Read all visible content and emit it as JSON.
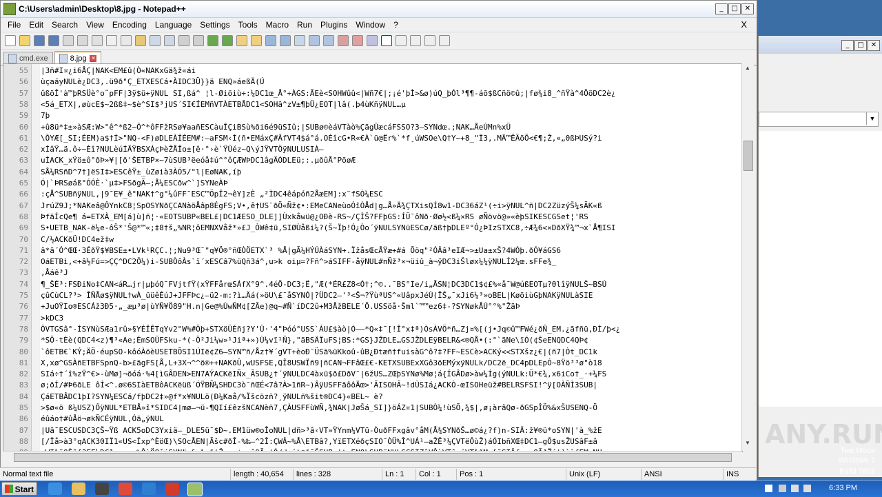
{
  "window": {
    "title": "C:\\Users\\admin\\Desktop\\8.jpg - Notepad++"
  },
  "menu": [
    "File",
    "Edit",
    "Search",
    "View",
    "Encoding",
    "Language",
    "Settings",
    "Tools",
    "Macro",
    "Run",
    "Plugins",
    "Window",
    "?"
  ],
  "menu_close": "X",
  "tabs": [
    {
      "label": "cmd.exe",
      "active": false
    },
    {
      "label": "8.jpg",
      "active": true
    }
  ],
  "lines": [
    {
      "n": "55",
      "text": "|3ñ#I¤¿i6ÅÇ|NAK<EM£û(Ò«NAKxGä¾ž«ái"
    },
    {
      "n": "56",
      "text": "ùçaáyNULè¿DC3,.ü9ð\"Ç_ETXESCá•ÀIDC3Ü}}ä ENQ»áeßÄ(Ú"
    },
    {
      "n": "57",
      "text": "ûßöÎ'à™þRSÜè°o˜pFF|3ÿ$ü+ÿNUL  SI,ßá^ ¦l-Øiöiù÷:¼DC1œ_Å°÷ÀGS:ÃEè<SOHWûû<|Wñ7€|;¡é'þÌ>&ø)úQ_þÓl³¶¶-áõ$ßCñö©û;|fø¾i8_^ñŸà^4ÖöDC2è¿"
    },
    {
      "n": "58",
      "text": "<5á_ETX|,øùcE$~2ßß‡~$è^SI$³jUS´SI€ÍEMñVTÀETBÅDC1<SOHâ^zV±¶þÜ¿EOT|lâ(.þ4ùKñÿNUL…µ"
    },
    {
      "n": "59",
      "text": "7þ"
    },
    {
      "n": "60",
      "text": "+û8ü*‡±»àSÆ:W>\"ê^*ß2~Ô^*ôFFžRSø¥aañESCàuÎÇiBSù%ði6é9üSIû;|SUBø©èáVTàò%ÇãgÜæcáFSSO?3—SYNdœ.;NAK…ÅeÙMn%xÜ"
    },
    {
      "n": "61",
      "text": "\\ÔYÆ[_SI;ÉEM)a$†Í>\"NQ-<F)øDLEÀÍÉEM#:—aFSM‹Í(ñ•EMáxÇ#ÂfVT4$á°á.OÈîcG•R«€À`ü@Ër%`*f¸úWSOe\\Q†Y~+8_\"Ï3,.MÄ™ÊÃõÕ<€¶;Ž‚«„0ßÞUSý?i"
    },
    {
      "n": "62",
      "text": "xÍâŸ…ä.ô÷~Èî?NULèúÍÄŸBSXÁçÞèŽÅÎo±[ê·°›è`ŸÜéz~Q\\ýJŸVTÖÿNULUSIÀ–"
    },
    {
      "n": "63",
      "text": "uÍACK_xŸö±ô°ðÞ»¥|[ð'ŠETBP×~7ùSUB³ëeóå‡ú^°ôÇÆWÞDC1âgÄÓDLEü;:.µðûÅ°PõøÆ"
    },
    {
      "n": "64",
      "text": "SÅ¼RSñD^7†]ëSI‡>ESCêŸ±_ùZøià3ÀÓ5/\"l|EøNAK,íþ"
    },
    {
      "n": "65",
      "text": "Ó|`ÞRSøáß°ÓÓÈ·`µ‡>FSðgÃ—;Å¼ESCðw^`]SYNeÀÞ"
    },
    {
      "n": "66",
      "text": ":çÅ^SUBñÿNUL,|9¯E¥_ê°NAK†^g°¼ûFF¯ESC™ÖpÎ2¬êY]zÈ    „²ÌDC4êápóñ2ÅæEM]:x¨fSÒ¼ESC"
    },
    {
      "n": "67",
      "text": "JrúZ9J;*NAKeâ@ÔYnkC8¦SpOSYNðÇCANàöÅâp8ÉgFS;V•,ê†US¨ðÕ«Ñž¢•:EMeCANeùoÓîÒÅd|g…Å»Ä¾ÇTXisQÍ8w1-DC36áZ¹(÷i>ÿNUL^ñ|DC2ZüzýŠ¼sÃK«ß"
    },
    {
      "n": "68",
      "text": "ÞfãÍcQe¶    á=ETXÀ_EM[á]ù]ñ¦·«EOTSUBP«BEL£|DC1ÆESO_DLE]]Ùxkåwü@¿OÐè-RS~/ÇÌŠ?FFþGS:ÍÜ¯ôNð·Øø½<ß¼×RS  øÑövö@»«èþSIKESCGSet¦'RS"
    },
    {
      "n": "69",
      "text": "S•UETB_NAK-ë¼e-ôŠ*'Š@*™«;‡8†š„%NR¦ôEMNXVåž*»£J_ÒWê‡ü,SIØÙåßi¼?(Š~Ïþ!Ó¿Òo´ÿNULSYNüESCø/ãß†þDLEº°Ó¿ÞIzSTXC8,÷Æ¾6<×DðXŸ¾™¬x`Å¶ISI"
    },
    {
      "n": "70",
      "text": "C/½ACKðÜ!DC4ež‡w"
    },
    {
      "n": "71",
      "text": "â*â´Ó^ŒŒ·3ÉðŸ$¥BSE±•LVk¹RÇC.¦;Nu9³Œ¯\"q¥Ö®°ñŒÒÖETX`³   %Å|gÃ¼HÝÚÀáSYN+.ÏžåsŒcÅŸæ+#á    Õöq\"²ÓÂâ³eIÆ¬>±Ua±xŠ?4WÓþ.ðÓ¥áGS6"
    },
    {
      "n": "72",
      "text": "OáETBì,<+â½Fú=>ÇÇ^DC2Ô¼)i-SUBÒôÀs`ï´xESCâ7%üQñ3á^,u>k  oiµ=?Fñ^>áSIFF-åÿNUL#nÑž³×¬üiû_à¬ÿDC3iŠløx¼¼ÿNULÍ2¼œ.sFFe¾_"
    },
    {
      "n": "73",
      "text": ",Åáê³J"
    },
    {
      "n": "74",
      "text": "¶_ŠÉ³:FSÐiNo‡CAN<áR…jr|µþóQ¯FVjtfŸ(xŸFFårœSÁfX°9^.4éÕ-DC3;Ë,\"Æ(*ÉR£Z8<Ó†;^©..¯BS°Ie/i„ÅSN¦DC3DC1$¢£%«å¯W@úßEOTµ?0lîÿNULŠ~BSÚ"
    },
    {
      "n": "75",
      "text": "çûCùCL?³>    ÎÑÅø$ÿNUL†wÀ_üüêÉúJ+JFFÞc¿—ü2-m:?ì…Äá(»öU\\£¯åSYNÓ|?ÜDC2—'³<Š¬?ŸùªUS^«UâpxJéÙ(ÎŠ„¯xJi6¼³»oBEL|KøöiùGþNAKÿNULàSIE"
    },
    {
      "n": "76",
      "text": "+JuOŸIo®ESCÁž3Ð5·„_æµ³ø|ùYÑ¥Ö89\"H.n|Ge@%ÙwÑM¢[ZÃe)@q~#Ñ`íDC2û+M3ÅžBELE´Õ.USSöå·Šml`™™ez6‡-?SYNøkÅÚ°°%\"ŽäÞ"
    },
    {
      "n": "77",
      "text": ">kDC3"
    },
    {
      "n": "78",
      "text": "ÔVTGSâ°-ÌSYNùSÆa1rû»§YÉÎÊTqYv2\"W%#Öþ+STXöÜÉñj?Y'Û·'4\"Þóó°USS`ÁU£$àò|Ó––*Q«‡¯[!Î°x‡ª)ÒsÀVÖ*ñ…Zj¤%[(j•Jq©û™FWé¿ðÑ_EM.¿ãfñü,ÐÌ/þ<¿"
    },
    {
      "n": "79",
      "text": "*SÖ-tÈè(QDC4<z)¶³«Ae;ÉmSOÜFSku-*(-Ö²Ji¼w»¹Jiª+»)Ù¼vï¹Ñ},\"ãBSÄÏuFS¦BS:*GS}JŽDLE…GSJŽDLEÿBELR&<®QÅ•(:°`ãNe\\ïÓ(¢ŠeENQDC4QÞ¢"
    },
    {
      "n": "80",
      "text": "`ôETB€`KÝ;ÄÖ·éupSO-kôóÀöèUSETBÕSI1ÚIë¢Z6—SYN™ñ/Åz†¥´gVT+èoÐ¯ÜSã%üKkoû-ûB¿Ðtæñ†fuisàG^ô?‡?FF~ESCè>ACKý<<STXšz¿€|(ñ7|Òt_DC1k"
    },
    {
      "n": "81",
      "text": "X,xø^GSÀñETBFSpnQ-b>£ãgFS[Å,L+3X¬^^ö®++NAKðÛ,wUSFSE,QÎ8USWÏñ9|ñCAN¬FFâŒ£€-KETXSUBExXGô3öEMýxÿNULk/DC2ë_DC4pDLEpÓ~8Ÿö³³ø\"ò18"
    },
    {
      "n": "82",
      "text": "SIá÷†´î%zŸ^€>-ùMø]¬öóá·%4[ìGÂDEN>EN7AÝACKëIÑx_ÃSUB¿†´ÿNULDC4àxü$ð£DðV¯|6žUS…ZŒþSYNø%Mø¦á{ÍGÂDø>àw¼Íg(ýNULk:Ü*€¾,x6iCo†_·+¼FS"
    },
    {
      "n": "83",
      "text": "ø;ðÍ/#Þ6ðLE  ôÍ<^.ø©6SIàETBôACKëüß´ÓŸBÑ¼SHDC3ò¯ñŒÉ<7â?À>1ñR~)ÂÿUSFFãôôÄœ>'ÃISOHÃ~!dÙSIá¿ACKÒ-œISOHeüž#BELRSFSI!^ÿ[OÀÑÌ3SUB|"
    },
    {
      "n": "84",
      "text": "ÇáETBÂDC1þI?SYN¼ESCá/fþDC2‡»@f*x¥NULö(Ð¼Kaå/%Ïšcözñ?¸ÿNULñ%šit®DC4}«BEL~ è?"
    },
    {
      "n": "85",
      "text": ">$ø«ö ß¼USZ)ÔÿNUL*ETBÅ»î*SIDC4|mø—¬ü-¶QIí£êzšNCANèñ7,ÇÀUSFFùWÑ,¾NAK|JøŠá_SI]}öÁZ¤1|SUBÒ¼!ùSÕ,¾$|,ø¡àrâQø-ðGSpÎÖ%&xŠUSENQ-Ö"
    },
    {
      "n": "86",
      "text": "éûáo†#ûÅö¬økÑCÉÿNUL,Óã„ÿNUL"
    },
    {
      "n": "87",
      "text": "|Uâ¯ESCUSDC3ÇŠ~Ÿß ACK5oDC3Yxiä–_DLE5ü¯$Ð~.EM1üw®oÎoNUL|dñ>³â‹VT»ŸYnm¼VTü-ÒuðFFxgâv°åM(Å¾SYNðŠ…ø©á¿?f)n-SIÄ:ž¥®ü*oSYN|'à_%žE"
    },
    {
      "n": "88",
      "text": "[/Ïå>à3°qACK30IÏ1«US<Íxp^ÈöŒ)\\SOcÅEN|Ãšc#ðÎ-%‰—^2Î:ÇWÂ~%Å\\ETBâ?,YïETXéðçSIO¯ÒÜ%Î^UÁ¹–aŽÊ³¼ÇVTëÔùŽ)áÓIbñXŒ‡DC1—gÔ$usŽUSâF±â"
    },
    {
      "n": "89",
      "text": "øWI¾ñßÈîf?FF¼DC1mcxm~%ÔùÖ8šáSYN\"s&,¾>ð‡Ž¿se¢x,êßÃ~(Ó/d-á)®ð¯ŠSUB-‡t_ENQkSUBÿNULSGSIZâVÔùVTâ×úVT¾ðMw[ñSIÂfucxOÃ³Žá|¹àèfEMgNU"
    }
  ],
  "status": {
    "file_type": "Normal text file",
    "length": "length : 40,654",
    "lines": "lines : 328",
    "ln": "Ln : 1",
    "col": "Col : 1",
    "pos": "Pos : 1",
    "eol": "Unix (LF)",
    "encoding": "ANSI",
    "mode": "INS"
  },
  "desktop": {
    "test_mode": "Test Mode",
    "os": "Windows 7",
    "build": "Build 7601",
    "watermark": "ANY.RUN"
  },
  "taskbar": {
    "start": "Start",
    "clock": "6:33 PM"
  },
  "colors": {
    "accent": "#2a74d4",
    "tab_active": "#f0a030",
    "control_char_bg": "#000000"
  }
}
